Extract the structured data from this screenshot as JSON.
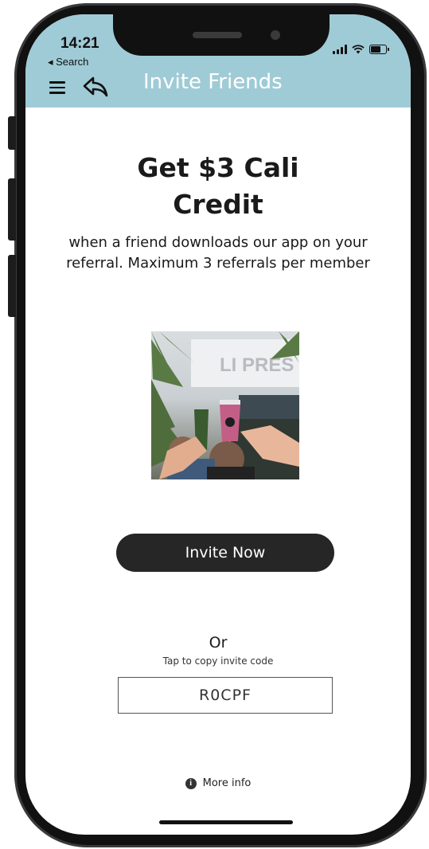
{
  "status_bar": {
    "time": "14:21",
    "back_app": "◂ Search"
  },
  "nav": {
    "title": "Invite Friends",
    "bar_color": "#9fcbd6",
    "menu_icon": "hamburger-menu-icon",
    "back_icon": "back-arrow-icon"
  },
  "promo": {
    "headline_line1": "Get $3 Cali",
    "headline_line2": "Credit",
    "subtext_line1": "when a friend downloads our app on your",
    "subtext_line2": "referral. Maximum 3 referrals per member",
    "photo_sign_text": "LI PRES"
  },
  "actions": {
    "invite_label": "Invite Now",
    "or_label": "Or",
    "tap_label": "Tap to copy invite code",
    "invite_code": "R0CPF",
    "more_info_label": "More info",
    "button_color": "#262626"
  }
}
